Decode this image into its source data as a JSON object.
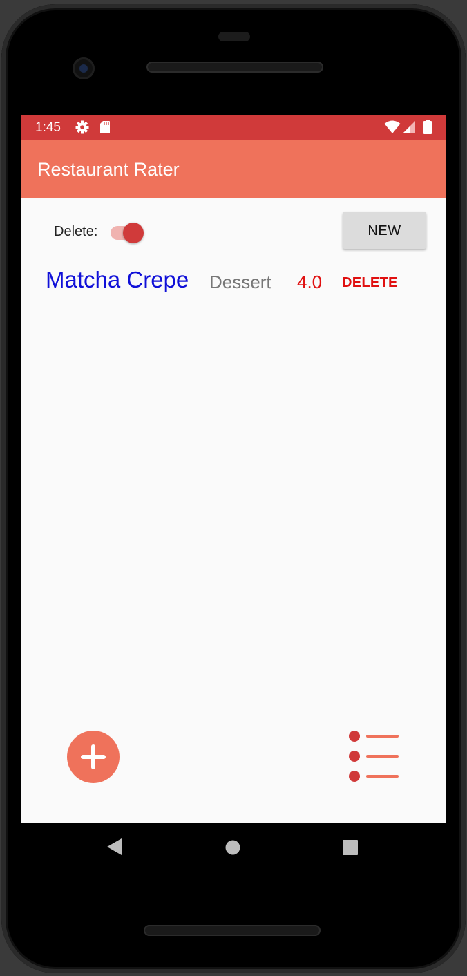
{
  "status_bar": {
    "time": "1:45",
    "icons": [
      "gear-icon",
      "sd-card-icon",
      "wifi-icon",
      "signal-icon",
      "battery-icon"
    ],
    "color": "#d03a3a"
  },
  "app_bar": {
    "title": "Restaurant Rater",
    "color": "#ef725b"
  },
  "controls": {
    "delete_label": "Delete:",
    "delete_switch_on": true,
    "new_button_label": "NEW"
  },
  "list": {
    "items": [
      {
        "name": "Matcha Crepe",
        "type": "Dessert",
        "rating": "4.0",
        "delete_label": "DELETE"
      }
    ]
  },
  "bottom_actions": {
    "add_icon": "plus-icon",
    "list_icon": "list-icon"
  },
  "navigation": {
    "icons": [
      "back-icon",
      "home-icon",
      "recents-icon"
    ]
  }
}
